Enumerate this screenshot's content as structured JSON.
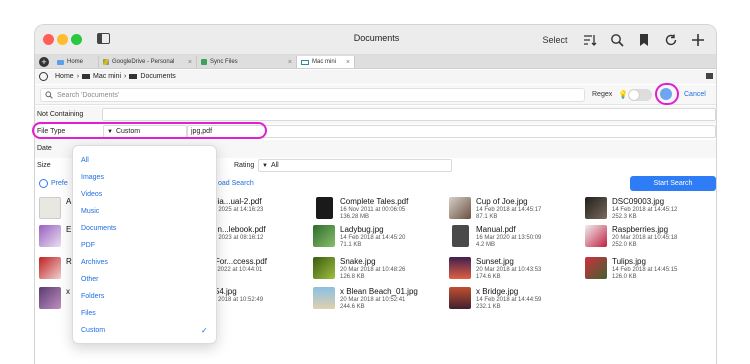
{
  "window": {
    "title": "Documents"
  },
  "toolbar": {
    "select_label": "Select"
  },
  "tabs": [
    {
      "label": "Home"
    },
    {
      "label": "GoogleDrive - Personal"
    },
    {
      "label": "Sync Files"
    },
    {
      "label": "Mac mini"
    }
  ],
  "path": [
    "Home",
    "Mac mini",
    "Documents"
  ],
  "search": {
    "placeholder": "Search 'Documents'",
    "regex_label": "Regex",
    "cancel_label": "Cancel"
  },
  "filters": {
    "not_containing_label": "Not Containing",
    "file_type_label": "File Type",
    "file_type_value": "Custom",
    "file_type_ext": "jpg,pdf",
    "date_label": "Date",
    "size_label": "Size",
    "rating_label": "Rating",
    "rating_value": "All",
    "prefs_label": "Prefe",
    "load_search": "oad Search",
    "start_search": "Start Search"
  },
  "dropdown": {
    "items": [
      "All",
      "Images",
      "Videos",
      "Music",
      "Documents",
      "PDF",
      "Archives",
      "Other",
      "Folders",
      "Files",
      "Custom"
    ],
    "selected": "Custom"
  },
  "files": {
    "col1": [
      {
        "name": "A",
        "date": "",
        "size": ""
      },
      {
        "name": "E",
        "date": "",
        "size": ""
      },
      {
        "name": "R",
        "date": "",
        "size": ""
      },
      {
        "name": "x",
        "date": "",
        "size": ""
      }
    ],
    "col2": [
      {
        "name": "ordia...ual-2.pdf",
        "date": "Sun 2025 at 14:16:23",
        "size": "B"
      },
      {
        "name": "rrain...lebook.pdf",
        "date": "Aug 2023 at 08:16:12",
        "size": "B"
      },
      {
        "name": "upFor...ccess.pdf",
        "date": "Jun 2022 at 10:44:01",
        "size": "B"
      },
      {
        "name": "_954.jpg",
        "date": "Mar 2018 at 10:52:49",
        "size": "KB"
      }
    ],
    "col3": [
      {
        "name": "Complete Tales.pdf",
        "date": "16 Nov 2011 at 00:06:05",
        "size": "136.28 MB"
      },
      {
        "name": "Ladybug.jpg",
        "date": "14 Feb 2018 at 14:45:20",
        "size": "71.1 KB"
      },
      {
        "name": "Snake.jpg",
        "date": "20 Mar 2018 at 10:48:26",
        "size": "126.8 KB"
      },
      {
        "name": "x Blean Beach_01.jpg",
        "date": "20 Mar 2018 at 10:52:41",
        "size": "244.6 KB"
      }
    ],
    "col4": [
      {
        "name": "Cup of Joe.jpg",
        "date": "14 Feb 2018 at 14:45:17",
        "size": "87.1 KB"
      },
      {
        "name": "Manual.pdf",
        "date": "16 Mar 2020 at 13:50:09",
        "size": "4.2 MB"
      },
      {
        "name": "Sunset.jpg",
        "date": "20 Mar 2018 at 10:43:53",
        "size": "174.6 KB"
      },
      {
        "name": "x Bridge.jpg",
        "date": "14 Feb 2018 at 14:44:59",
        "size": "232.1 KB"
      }
    ],
    "col5": [
      {
        "name": "DSC09003.jpg",
        "date": "14 Feb 2018 at 14:45:12",
        "size": "252.3 KB"
      },
      {
        "name": "Raspberries.jpg",
        "date": "20 Mar 2018 at 10:45:18",
        "size": "252.0 KB"
      },
      {
        "name": "Tulips.jpg",
        "date": "14 Feb 2018 at 14:45:15",
        "size": "126.0 KB"
      },
      {
        "name": "",
        "date": "",
        "size": ""
      }
    ]
  },
  "colors": {
    "accent": "#2f7df6",
    "highlight": "#e020d0"
  }
}
